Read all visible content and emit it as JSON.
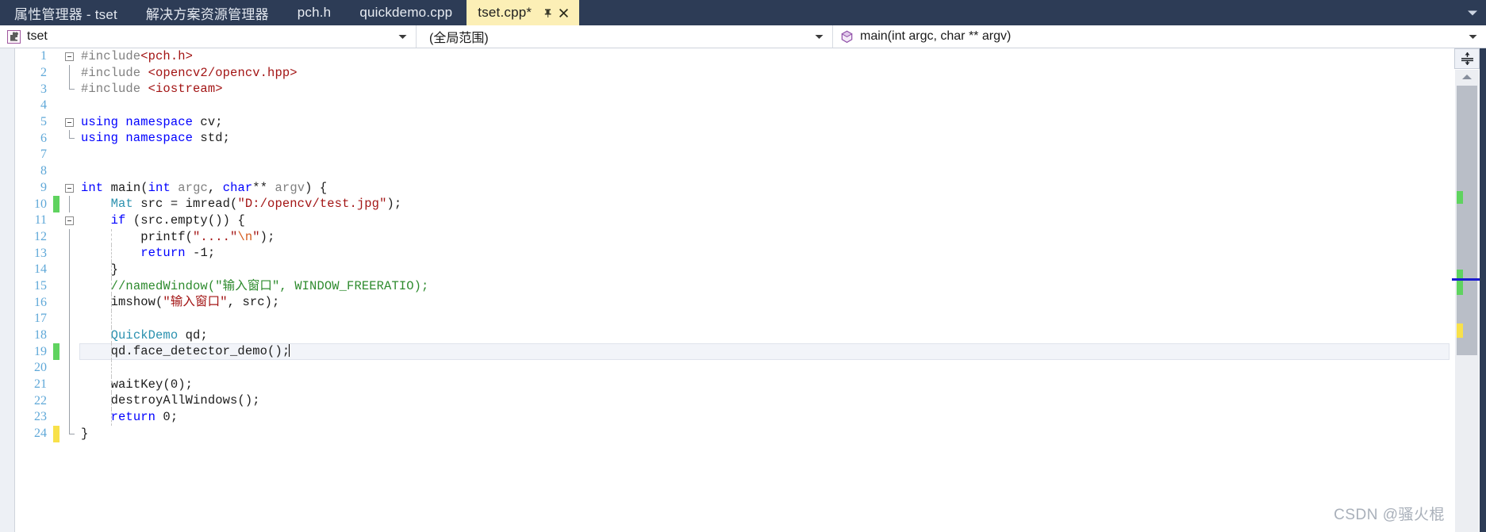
{
  "tabs": [
    {
      "label": "属性管理器 - tset",
      "active": false
    },
    {
      "label": "解决方案资源管理器",
      "active": false
    },
    {
      "label": "pch.h",
      "active": false
    },
    {
      "label": "quickdemo.cpp",
      "active": false
    },
    {
      "label": "tset.cpp*",
      "active": true
    }
  ],
  "navbar": {
    "project": "tset",
    "scope": "(全局范围)",
    "function": "main(int argc, char ** argv)"
  },
  "watermark": "CSDN @骚火棍",
  "editor": {
    "colors": {
      "keyword": "#0000ff",
      "string": "#a31515",
      "comment": "#2e8b2e",
      "type": "#2b91af",
      "preprocessor": "#808080",
      "line_number": "#5fa8d8",
      "changed_saved": "#5fd35f",
      "changed_unsaved": "#f8e14a",
      "tab_active_bg": "#fcefb6",
      "tabstrip_bg": "#2d3c56"
    },
    "lines": [
      {
        "n": 1,
        "text": "#include<pch.h>"
      },
      {
        "n": 2,
        "text": "#include <opencv2/opencv.hpp>"
      },
      {
        "n": 3,
        "text": "#include <iostream>"
      },
      {
        "n": 4,
        "text": ""
      },
      {
        "n": 5,
        "text": "using namespace cv;"
      },
      {
        "n": 6,
        "text": "using namespace std;"
      },
      {
        "n": 7,
        "text": ""
      },
      {
        "n": 8,
        "text": ""
      },
      {
        "n": 9,
        "text": "int main(int argc, char** argv) {"
      },
      {
        "n": 10,
        "text": "    Mat src = imread(\"D:/opencv/test.jpg\");"
      },
      {
        "n": 11,
        "text": "    if (src.empty()) {"
      },
      {
        "n": 12,
        "text": "        printf(\"....\\n\");"
      },
      {
        "n": 13,
        "text": "        return -1;"
      },
      {
        "n": 14,
        "text": "    }"
      },
      {
        "n": 15,
        "text": "    //namedWindow(\"输入窗口\", WINDOW_FREERATIO);"
      },
      {
        "n": 16,
        "text": "    imshow(\"输入窗口\", src);"
      },
      {
        "n": 17,
        "text": ""
      },
      {
        "n": 18,
        "text": "    QuickDemo qd;"
      },
      {
        "n": 19,
        "text": "    qd.face_detector_demo();"
      },
      {
        "n": 20,
        "text": ""
      },
      {
        "n": 21,
        "text": "    waitKey(0);"
      },
      {
        "n": 22,
        "text": "    destroyAllWindows();"
      },
      {
        "n": 23,
        "text": "    return 0;"
      },
      {
        "n": 24,
        "text": "}"
      }
    ]
  }
}
